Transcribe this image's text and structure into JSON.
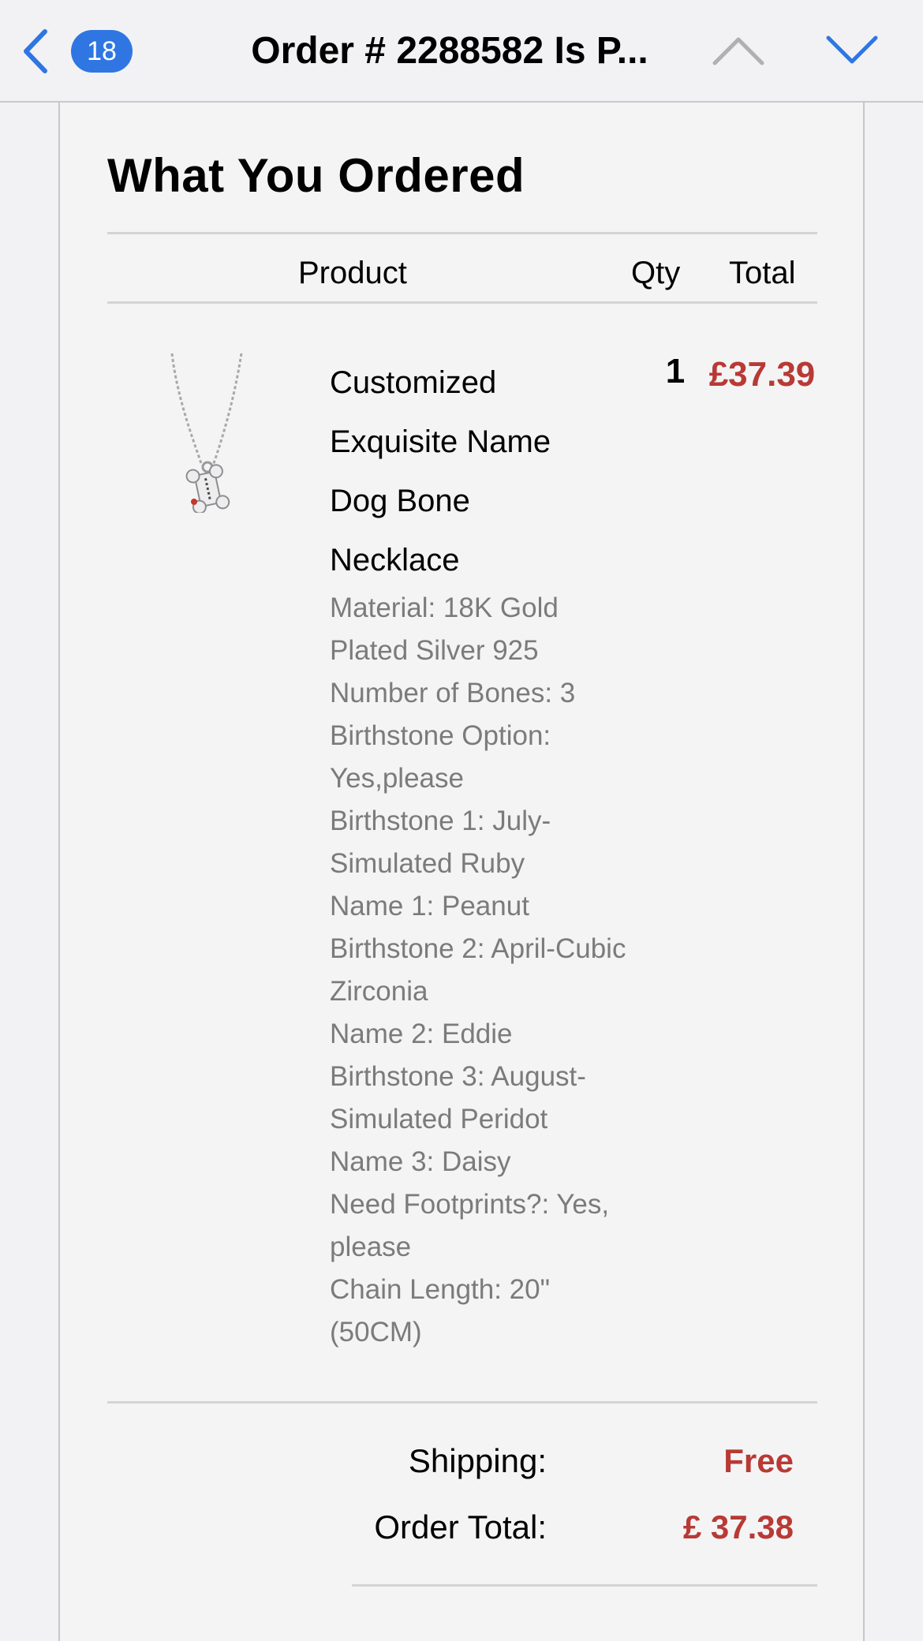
{
  "nav": {
    "badge_count": "18",
    "title": "Order # 2288582 Is P...",
    "back_icon": "chevron-left-icon",
    "up_icon": "chevron-up-icon",
    "down_icon": "chevron-down-icon",
    "accent_color": "#2f76e3"
  },
  "order": {
    "heading": "What You Ordered",
    "columns": {
      "product": "Product",
      "qty": "Qty",
      "total": "Total"
    },
    "item": {
      "name_lines": [
        "Customized",
        "Exquisite Name",
        "Dog Bone",
        "Necklace"
      ],
      "options": [
        "Material: 18K Gold Plated Silver 925",
        "Number of Bones: 3",
        "Birthstone Option: Yes,please",
        "Birthstone 1: July-Simulated Ruby",
        "Name 1: Peanut",
        "Birthstone 2: April-Cubic Zirconia",
        "Name 2: Eddie",
        "Birthstone 3: August-Simulated Peridot",
        "Name 3: Daisy",
        "Need Footprints?: Yes, please",
        "Chain Length: 20\" (50CM)"
      ],
      "qty": "1",
      "price": "£37.39"
    },
    "summary": {
      "shipping_label": "Shipping:",
      "shipping_value": "Free",
      "total_label": "Order Total:",
      "total_value": "£ 37.38"
    },
    "price_color": "#b83a35"
  }
}
